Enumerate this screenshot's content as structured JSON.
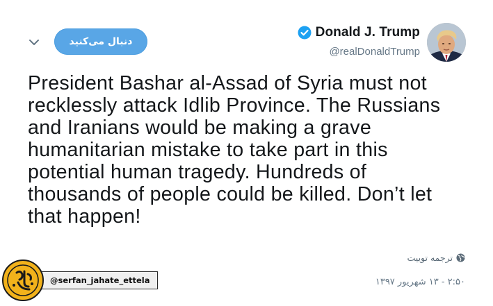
{
  "tweet": {
    "follow_label": "دنبال می‌کنید",
    "display_name": "Donald J. Trump",
    "handle": "@realDonaldTrump",
    "text": "President Bashar al-Assad of Syria must not\nrecklessly attack Idlib Province. The Russians\nand Iranians would be making a grave\nhumanitarian mistake to take part in this\npotential human tragedy. Hundreds of\nthousands of people could be killed. Don’t let\nthat happen!",
    "translate_label": "ترجمه توییت",
    "timestamp": "۲:۵۰ - ۱۳ شهریور ۱۳۹۷"
  },
  "watermark": {
    "handle": "@serfan_jahate_ettela",
    "logo_text": "اطلاع جهت صرفا"
  },
  "colors": {
    "follow_button": "#59a6e6",
    "verified": "#1da1f2",
    "text": "#14171a",
    "secondary": "#657786",
    "watermark_logo": "#f2b21b"
  },
  "icons": {
    "chevron": "chevron-down-icon",
    "verified": "verified-badge-icon",
    "globe": "globe-icon"
  }
}
